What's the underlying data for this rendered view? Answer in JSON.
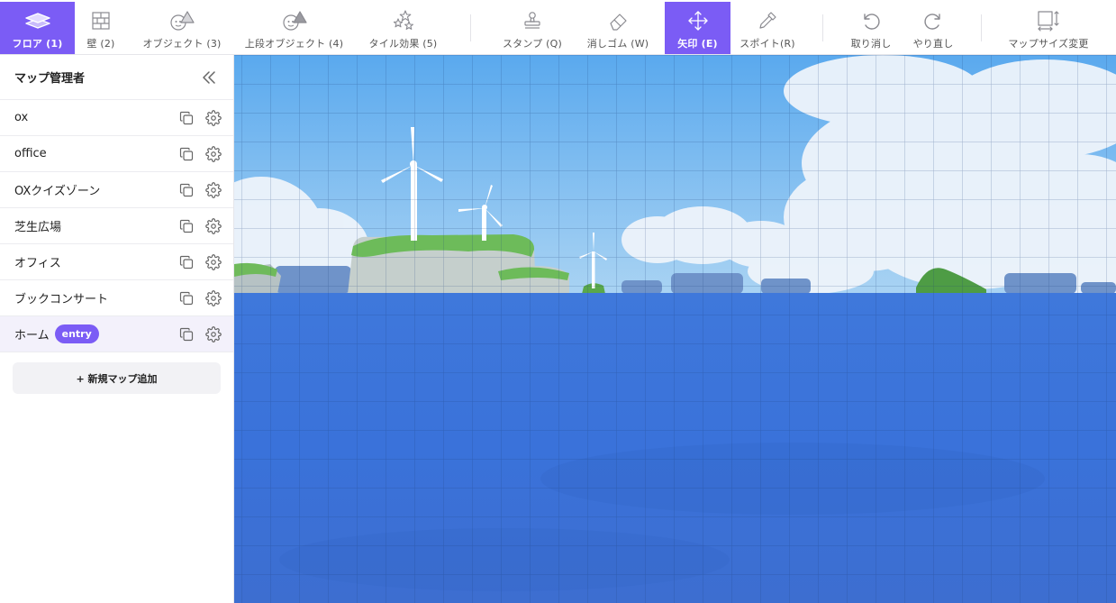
{
  "toolbar": {
    "tools": [
      {
        "label": "フロア (1)",
        "icon": "layers-icon"
      },
      {
        "label": "壁 (2)",
        "icon": "brick-wall-icon"
      },
      {
        "label": "オブジェクト (3)",
        "icon": "object-shapes-icon"
      },
      {
        "label": "上段オブジェクト (4)",
        "icon": "upper-object-shapes-icon"
      },
      {
        "label": "タイル効果 (5)",
        "icon": "sparkle-stars-icon"
      },
      {
        "label": "スタンプ (Q)",
        "icon": "stamp-icon"
      },
      {
        "label": "消しゴム (W)",
        "icon": "eraser-icon"
      },
      {
        "label": "矢印 (E)",
        "icon": "move-arrows-icon"
      },
      {
        "label": "スポイト(R)",
        "icon": "eyedropper-icon"
      },
      {
        "label": "取り消し",
        "icon": "undo-icon"
      },
      {
        "label": "やり直し",
        "icon": "redo-icon"
      },
      {
        "label": "マップサイズ変更",
        "icon": "resize-map-icon"
      }
    ],
    "active_tools": [
      "フロア (1)",
      "矢印 (E)"
    ],
    "accent_color": "#7b5cf5"
  },
  "sidebar": {
    "title": "マップ管理者",
    "collapse_icon": "double-chevron-left-icon",
    "maps": [
      {
        "name": "ox"
      },
      {
        "name": "office"
      },
      {
        "name": "OXクイズゾーン"
      },
      {
        "name": "芝生広場"
      },
      {
        "name": "オフィス"
      },
      {
        "name": "ブックコンサート"
      },
      {
        "name": "ホーム",
        "badge": "entry",
        "selected": true
      }
    ],
    "row_icons": [
      "duplicate-icon",
      "gear-icon"
    ],
    "add_button": "+ 新規マップ追加"
  },
  "canvas": {
    "background": "sea-with-islands-and-wind-turbines",
    "grid": true
  }
}
